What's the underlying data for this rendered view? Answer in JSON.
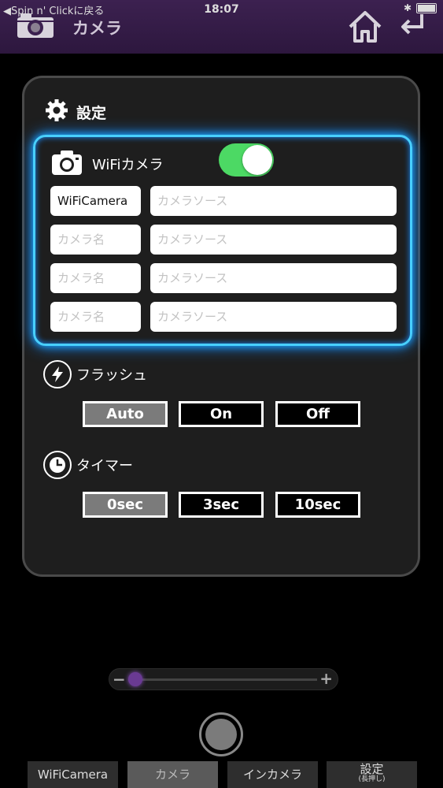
{
  "status_bar": {
    "back_text": "◀Spin n' Clickに戻る",
    "time": "18:07",
    "bluetooth": "✱"
  },
  "header": {
    "title": "カメラ",
    "icons": [
      "camera-logo-icon",
      "home-icon",
      "return-icon"
    ],
    "color": "#2d173e"
  },
  "settings": {
    "title": "設定",
    "wifi_camera": {
      "label": "WiFiカメラ",
      "enabled": true,
      "cameras": [
        {
          "name": "WiFiCamera",
          "source_placeholder": "カメラソース"
        },
        {
          "name_placeholder": "カメラ名",
          "source_placeholder": "カメラソース"
        },
        {
          "name_placeholder": "カメラ名",
          "source_placeholder": "カメラソース"
        },
        {
          "name_placeholder": "カメラ名",
          "source_placeholder": "カメラソース"
        }
      ]
    },
    "flash": {
      "label": "フラッシュ",
      "options": [
        "Auto",
        "On",
        "Off"
      ],
      "selected": "Auto"
    },
    "timer": {
      "label": "タイマー",
      "options": [
        "0sec",
        "3sec",
        "10sec"
      ],
      "selected": "0sec"
    }
  },
  "zoom": {
    "minus": "−",
    "plus": "+",
    "level": 0.0
  },
  "tabs": [
    {
      "label": "WiFiCamera",
      "active": false
    },
    {
      "label": "カメラ",
      "active": true
    },
    {
      "label": "インカメラ",
      "active": false
    },
    {
      "label": "設定",
      "sub": "(長押し)",
      "active": false
    }
  ],
  "colors": {
    "accent_glow": "#48cfff",
    "toggle_on": "#4cd964",
    "header_bg": "#3c2150",
    "slider_thumb": "#6a3a93"
  }
}
